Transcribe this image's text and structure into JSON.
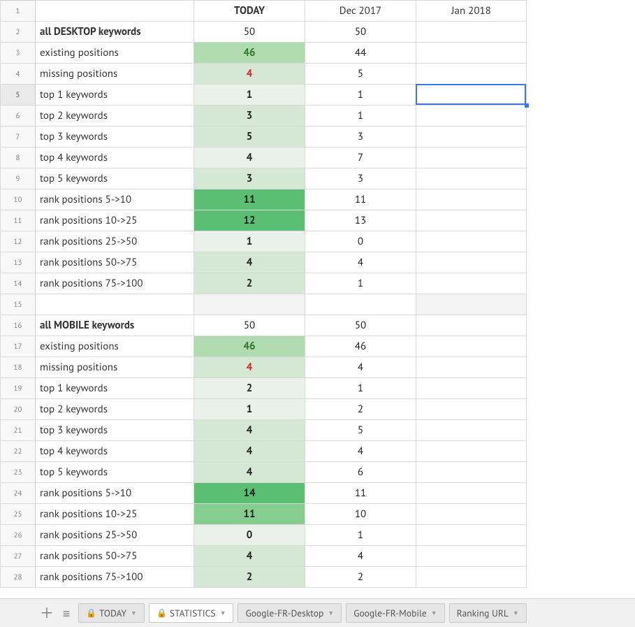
{
  "columns": {
    "today": "TODAY",
    "c2": "Dec 2017",
    "c3": "Jan 2018"
  },
  "rows": [
    {
      "n": 1,
      "type": "head"
    },
    {
      "n": 2,
      "label": "all DESKTOP keywords",
      "bold": true,
      "b": 50,
      "c": 50,
      "shade": ""
    },
    {
      "n": 3,
      "label": "existing positions",
      "b": 46,
      "c": 44,
      "shade": "green3",
      "bstyle": "num-green"
    },
    {
      "n": 4,
      "label": "missing positions",
      "b": 4,
      "c": 5,
      "shade": "green2",
      "bstyle": "num-red"
    },
    {
      "n": 5,
      "label": "top 1 keywords",
      "b": 1,
      "c": 1,
      "shade": "green1",
      "sel": true
    },
    {
      "n": 6,
      "label": "top 2 keywords",
      "b": 3,
      "c": 1,
      "shade": "green2"
    },
    {
      "n": 7,
      "label": "top 3 keywords",
      "b": 5,
      "c": 3,
      "shade": "green2"
    },
    {
      "n": 8,
      "label": "top 4 keywords",
      "b": 4,
      "c": 7,
      "shade": "green1"
    },
    {
      "n": 9,
      "label": "top 5 keywords",
      "b": 3,
      "c": 3,
      "shade": "green2"
    },
    {
      "n": 10,
      "label": "rank positions 5->10",
      "b": 11,
      "c": 11,
      "shade": "green5"
    },
    {
      "n": 11,
      "label": "rank positions 10->25",
      "b": 12,
      "c": 13,
      "shade": "green5"
    },
    {
      "n": 12,
      "label": "rank positions 25->50",
      "b": 1,
      "c": 0,
      "shade": "green1"
    },
    {
      "n": 13,
      "label": "rank positions 50->75",
      "b": 4,
      "c": 4,
      "shade": "green2"
    },
    {
      "n": 14,
      "label": "rank positions 75->100",
      "b": 2,
      "c": 1,
      "shade": "green2"
    },
    {
      "n": 15,
      "type": "blank"
    },
    {
      "n": 16,
      "label": "all MOBILE keywords",
      "bold": true,
      "b": 50,
      "c": 50,
      "shade": ""
    },
    {
      "n": 17,
      "label": "existing positions",
      "b": 46,
      "c": 46,
      "shade": "green3",
      "bstyle": "num-green"
    },
    {
      "n": 18,
      "label": "missing positions",
      "b": 4,
      "c": 4,
      "shade": "green2",
      "bstyle": "num-red"
    },
    {
      "n": 19,
      "label": "top 1 keywords",
      "b": 2,
      "c": 1,
      "shade": "green1"
    },
    {
      "n": 20,
      "label": "top 2 keywords",
      "b": 1,
      "c": 2,
      "shade": "green1"
    },
    {
      "n": 21,
      "label": "top 3 keywords",
      "b": 4,
      "c": 5,
      "shade": "green2"
    },
    {
      "n": 22,
      "label": "top 4 keywords",
      "b": 4,
      "c": 4,
      "shade": "green2"
    },
    {
      "n": 23,
      "label": "top 5 keywords",
      "b": 4,
      "c": 6,
      "shade": "green2"
    },
    {
      "n": 24,
      "label": "rank positions 5->10",
      "b": 14,
      "c": 11,
      "shade": "green5"
    },
    {
      "n": 25,
      "label": "rank positions 10->25",
      "b": 11,
      "c": 10,
      "shade": "green4"
    },
    {
      "n": 26,
      "label": "rank positions 25->50",
      "b": 0,
      "c": 1,
      "shade": "green1"
    },
    {
      "n": 27,
      "label": "rank positions 50->75",
      "b": 4,
      "c": 4,
      "shade": "green2"
    },
    {
      "n": 28,
      "label": "rank positions 75->100",
      "b": 2,
      "c": 2,
      "shade": "green2"
    }
  ],
  "tabs": [
    {
      "label": "TODAY",
      "locked": true,
      "active": false
    },
    {
      "label": "STATISTICS",
      "locked": true,
      "active": true
    },
    {
      "label": "Google-FR-Desktop",
      "locked": false,
      "active": false
    },
    {
      "label": "Google-FR-Mobile",
      "locked": false,
      "active": false
    },
    {
      "label": "Ranking URL",
      "locked": false,
      "active": false
    }
  ],
  "activeCell": {
    "row": 5,
    "col": "D"
  }
}
